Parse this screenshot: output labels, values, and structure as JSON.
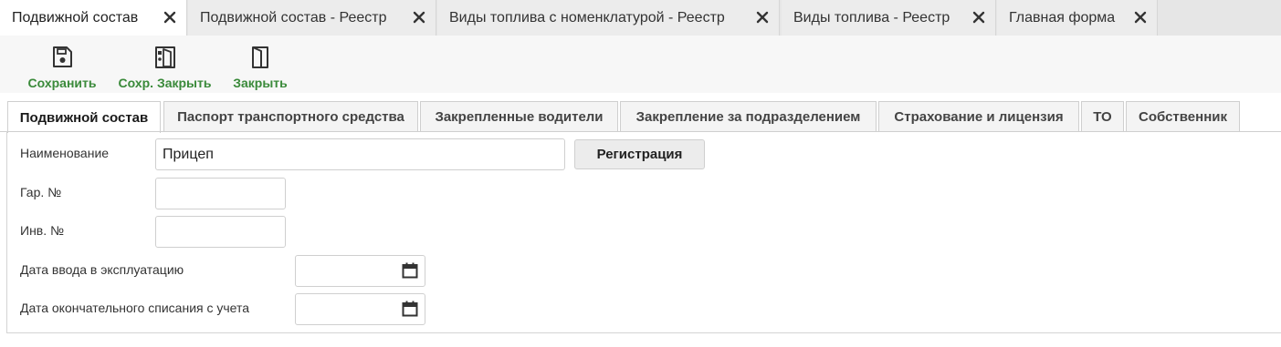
{
  "doc_tabs": [
    {
      "label": "Подвижной состав",
      "active": true
    },
    {
      "label": "Подвижной состав - Реестр",
      "active": false
    },
    {
      "label": "Виды топлива с номенклатурой - Реестр",
      "active": false
    },
    {
      "label": "Виды топлива - Реестр",
      "active": false
    },
    {
      "label": "Главная форма",
      "active": false
    }
  ],
  "toolbar": {
    "save_label": "Сохранить",
    "save_close_label": "Сохр. Закрыть",
    "close_label": "Закрыть",
    "accent_color": "#3a8a3a"
  },
  "inner_tabs": [
    {
      "label": "Подвижной состав",
      "active": true
    },
    {
      "label": "Паспорт транспортного средства",
      "active": false
    },
    {
      "label": "Закрепленные водители",
      "active": false
    },
    {
      "label": "Закрепление за подразделением",
      "active": false
    },
    {
      "label": "Страхование и лицензия",
      "active": false
    },
    {
      "label": "ТО",
      "active": false
    },
    {
      "label": "Собственник",
      "active": false
    }
  ],
  "form": {
    "name_label": "Наименование",
    "name_value": "Прицеп",
    "registration_button": "Регистрация",
    "garage_no_label": "Гар. №",
    "garage_no_value": "",
    "inventory_no_label": "Инв. №",
    "inventory_no_value": "",
    "commission_date_label": "Дата ввода в эксплуатацию",
    "commission_date_value": "",
    "writeoff_date_label": "Дата окончательного списания с учета",
    "writeoff_date_value": ""
  },
  "icons": {
    "close": "close-icon",
    "save": "floppy-disk-icon",
    "save_close": "save-close-door-icon",
    "exit": "exit-door-icon",
    "calendar": "calendar-icon"
  }
}
